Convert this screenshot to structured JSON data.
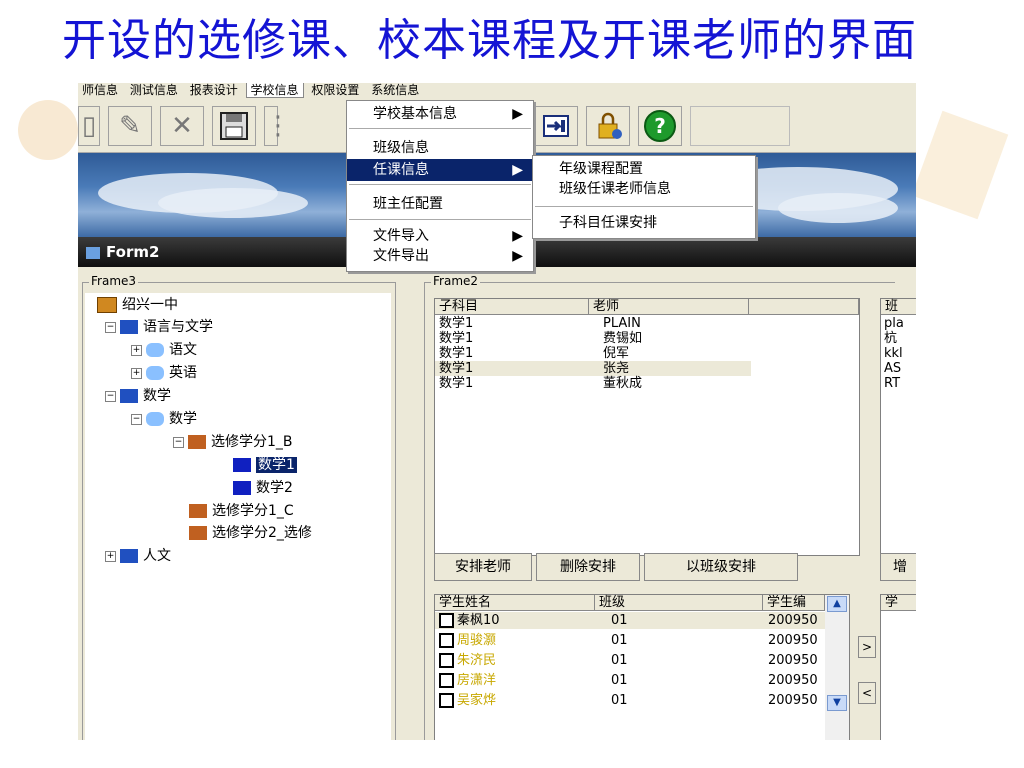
{
  "slide": {
    "title": "开设的选修课、校本课程及开课老师的界面"
  },
  "menubar": {
    "items": [
      "师信息",
      "测试信息",
      "报表设计",
      "学校信息",
      "权限设置",
      "系统信息"
    ]
  },
  "main_menu": {
    "items": [
      {
        "label": "学校基本信息",
        "arrow": "▶"
      },
      {
        "label": "班级信息",
        "arrow": ""
      },
      {
        "label": "任课信息",
        "arrow": "▶"
      },
      {
        "label": "班主任配置",
        "arrow": ""
      },
      {
        "label": "文件导入",
        "arrow": "▶"
      },
      {
        "label": "文件导出",
        "arrow": "▶"
      }
    ]
  },
  "sub_menu": {
    "items": [
      "年级课程配置",
      "班级任课老师信息",
      "子科目任课安排"
    ]
  },
  "window": {
    "title": "Form2"
  },
  "frame3": {
    "label": "Frame3"
  },
  "frame2": {
    "label": "Frame2"
  },
  "tree": {
    "school": "绍兴一中",
    "lang": "语言与文学",
    "chinese": "语文",
    "english": "英语",
    "math_group": "数学",
    "math": "数学",
    "elective1b": "选修学分1_B",
    "math1": "数学1",
    "math2": "数学2",
    "elective1c": "选修学分1_C",
    "elective2": "选修学分2_选修",
    "humanities": "人文"
  },
  "teacher_table": {
    "headers": [
      "子科目",
      "老师"
    ],
    "rows": [
      {
        "subject": "数学1",
        "teacher": "PLAIN"
      },
      {
        "subject": "数学1",
        "teacher": "费锡如"
      },
      {
        "subject": "数学1",
        "teacher": "倪军"
      },
      {
        "subject": "数学1",
        "teacher": "张尧"
      },
      {
        "subject": "数学1",
        "teacher": "董秋成"
      }
    ]
  },
  "right_list": {
    "header": "班",
    "rows": [
      "pla",
      "杭",
      "kkl",
      "AS",
      "RT"
    ]
  },
  "buttons": {
    "arrange": "安排老师",
    "delete": "删除安排",
    "by_class": "以班级安排",
    "add": "增"
  },
  "student_table": {
    "headers": [
      "学生姓名",
      "班级",
      "学生编"
    ],
    "rows": [
      {
        "name": "秦枫10",
        "class": "01",
        "id": "200950"
      },
      {
        "name": "周骏灏",
        "class": "01",
        "id": "200950"
      },
      {
        "name": "朱济民",
        "class": "01",
        "id": "200950"
      },
      {
        "name": "房潇洋",
        "class": "01",
        "id": "200950"
      },
      {
        "name": "吴家烨",
        "class": "01",
        "id": "200950"
      }
    ]
  },
  "move_buttons": {
    "right": ">",
    "left": "<"
  },
  "right_student_header": "学",
  "colors": {
    "title": "#1414d4",
    "selection": "#0a246a",
    "yellow_name": "#c8a800"
  }
}
